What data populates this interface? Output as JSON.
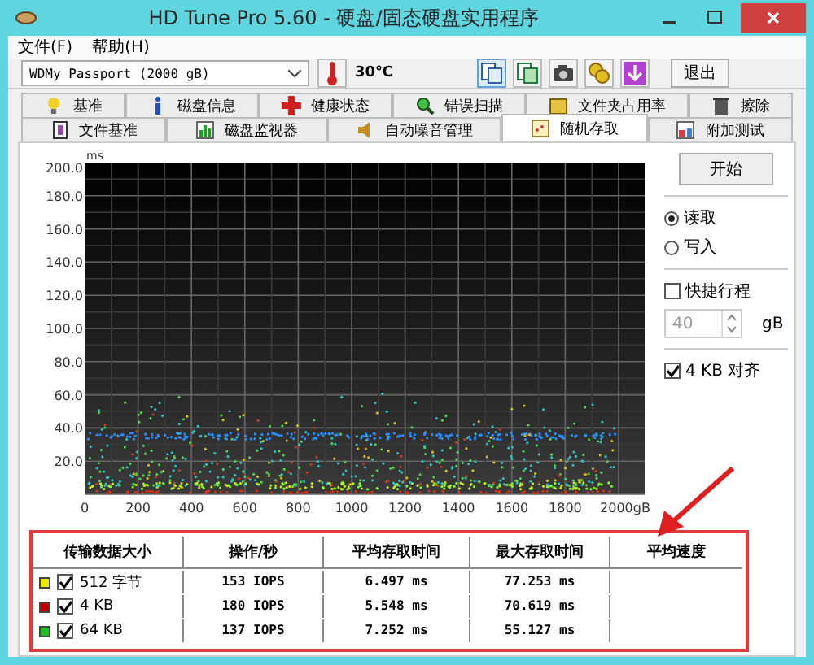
{
  "window": {
    "title": "HD Tune Pro 5.60 - 硬盘/固态硬盘实用程序"
  },
  "menu": [
    "文件(F)",
    "帮助(H)"
  ],
  "toolbar": {
    "drive": "WDMy Passport (2000 gB)",
    "temperature": "30℃",
    "exit": "退出"
  },
  "tabs_row1": [
    {
      "label": "基准",
      "selected": false
    },
    {
      "label": "磁盘信息",
      "selected": false
    },
    {
      "label": "健康状态",
      "selected": false
    },
    {
      "label": "错误扫描",
      "selected": false
    },
    {
      "label": "文件夹占用率",
      "selected": false
    },
    {
      "label": "擦除",
      "selected": false
    }
  ],
  "tabs_row2": [
    {
      "label": "文件基准",
      "selected": false
    },
    {
      "label": "磁盘监视器",
      "selected": false
    },
    {
      "label": "自动噪音管理",
      "selected": false
    },
    {
      "label": "随机存取",
      "selected": true
    },
    {
      "label": "附加测试",
      "selected": false
    }
  ],
  "plot": {
    "y_unit": "ms",
    "yticks": [
      "200.0",
      "180.0",
      "160.0",
      "140.0",
      "120.0",
      "100.0",
      "80.0",
      "60.0",
      "40.0",
      "20.0"
    ],
    "xticks": [
      "0",
      "200",
      "400",
      "600",
      "800",
      "1000",
      "1200",
      "1400",
      "1600",
      "1800",
      "2000gB"
    ]
  },
  "side": {
    "start": "开始",
    "modes": [
      {
        "label": "读取",
        "selected": true
      },
      {
        "label": "写入",
        "selected": false
      }
    ],
    "short_stroke": {
      "label": "快捷行程",
      "checked": false
    },
    "stroke_value": "40",
    "stroke_unit": "gB",
    "align": {
      "label": "4 KB 对齐",
      "checked": true
    }
  },
  "results": {
    "columns": [
      "传输数据大小",
      "操作/秒",
      "平均存取时间",
      "最大存取时间",
      "平均速度"
    ],
    "rows": [
      {
        "color": "#e8e800",
        "checked": true,
        "size": "512 字节",
        "ops": "153 IOPS",
        "avg": "6.497 ms",
        "max": "77.253 ms"
      },
      {
        "color": "#c00000",
        "checked": true,
        "size": "4 KB",
        "ops": "180 IOPS",
        "avg": "5.548 ms",
        "max": "70.619 ms"
      },
      {
        "color": "#20c020",
        "checked": true,
        "size": "64 KB",
        "ops": "137 IOPS",
        "avg": "7.252 ms",
        "max": "55.127 ms"
      }
    ]
  }
}
